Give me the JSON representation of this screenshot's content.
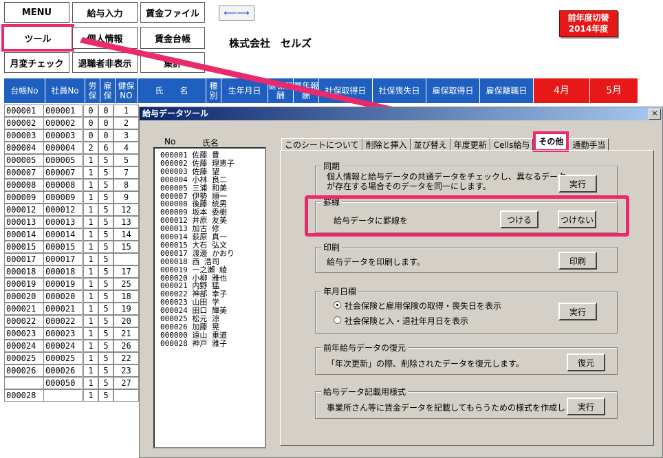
{
  "menu": {
    "items": [
      "MENU",
      "給与入力",
      "賃金ファイル",
      "ツール",
      "個人情報",
      "賃金台帳",
      "月変チェック",
      "退職者非表示",
      "集計"
    ]
  },
  "arrow_button": "⟵⟶",
  "company": "株式会社　セルズ",
  "prev_year": {
    "line1": "前年度切替",
    "line2": "2014年度"
  },
  "sheet": {
    "headers": [
      "台帳No",
      "社員No",
      "労保",
      "雇保",
      "健保NO",
      "氏　　名",
      "種別",
      "生年月日",
      "健保報酬",
      "厚年報酬",
      "社保取得日",
      "社保喪失日",
      "雇保取得日",
      "雇保離職日",
      "4月",
      "5月"
    ],
    "rows": [
      [
        "000001",
        "000001",
        "0",
        "0",
        "1"
      ],
      [
        "000002",
        "000002",
        "0",
        "0",
        "2"
      ],
      [
        "000003",
        "000003",
        "0",
        "0",
        "3"
      ],
      [
        "000004",
        "000004",
        "2",
        "6",
        "4"
      ],
      [
        "000005",
        "000005",
        "1",
        "5",
        "5"
      ],
      [
        "000007",
        "000007",
        "1",
        "5",
        "7"
      ],
      [
        "000008",
        "000008",
        "1",
        "5",
        "8"
      ],
      [
        "000009",
        "000009",
        "1",
        "5",
        "9"
      ],
      [
        "000012",
        "000012",
        "1",
        "5",
        "12"
      ],
      [
        "000013",
        "000013",
        "1",
        "5",
        "13"
      ],
      [
        "000014",
        "000014",
        "1",
        "5",
        "14"
      ],
      [
        "000015",
        "000015",
        "1",
        "5",
        "15"
      ],
      [
        "000017",
        "000017",
        "1",
        "5",
        ""
      ],
      [
        "000018",
        "000018",
        "1",
        "5",
        "17"
      ],
      [
        "000019",
        "000019",
        "1",
        "5",
        "25"
      ],
      [
        "000020",
        "000020",
        "1",
        "5",
        "18"
      ],
      [
        "000021",
        "000021",
        "1",
        "5",
        "19"
      ],
      [
        "000022",
        "000022",
        "1",
        "5",
        "20"
      ],
      [
        "000023",
        "000023",
        "1",
        "5",
        "21"
      ],
      [
        "000024",
        "000024",
        "1",
        "5",
        "26"
      ],
      [
        "000025",
        "000025",
        "1",
        "5",
        "22"
      ],
      [
        "000026",
        "000026",
        "1",
        "5",
        "23"
      ],
      [
        "",
        "000050",
        "1",
        "5",
        "27"
      ],
      [
        "000028",
        "",
        "1",
        "5",
        ""
      ]
    ]
  },
  "dialog": {
    "title": "給与データツール",
    "close": "×",
    "list_head_no": "No",
    "list_head_name": "氏名",
    "employees": [
      "000001 佐藤 豊",
      "000002 佐藤 理恵子",
      "000003 佐藤 望",
      "000004 小林 良二",
      "000005 三浦 和美",
      "000007 伊勢 順一",
      "000008 後藤 統男",
      "000009 坂本 委樹",
      "000012 井原 友美",
      "000013 加古 修",
      "000014 荻原 真一",
      "000015 大石 弘文",
      "000017 渡邊 かおり",
      "000018 西 浩司",
      "000019 一之瀬 綾",
      "000020 小柳 雅也",
      "000021 内野 猛",
      "000022 神部 幸子",
      "000023 山田 学",
      "000024 田口 輝美",
      "000025 松元 涼",
      "000026 加藤 晃",
      "000000 遠山 重道",
      "000028 神戸 雅子"
    ],
    "tabs": [
      "このシートについて",
      "削除と挿入",
      "並び替え",
      "年度更新",
      "Cells給与",
      "その他",
      "通勤手当"
    ],
    "groups": {
      "sync": {
        "title": "同期",
        "line1": "個人情報と給与データの共通データをチェックし、異なるデータ",
        "line2": "が存在する場合そのデータを同一にします。",
        "button": "実行"
      },
      "ruled": {
        "title": "罫線",
        "text": "給与データに罫線を",
        "button_on": "つける",
        "button_off": "つけない"
      },
      "print": {
        "title": "印刷",
        "text": "給与データを印刷します。",
        "button": "印刷"
      },
      "date": {
        "title": "年月日欄",
        "option1": "社会保険と雇用保険の取得・喪失日を表示",
        "option2": "社会保険と入・退社年月日を表示",
        "button": "実行"
      },
      "restore": {
        "title": "前年給与データの復元",
        "text": "「年次更新」の際、削除されたデータを復元します。",
        "button": "復元"
      },
      "form": {
        "title": "給与データ記載用様式",
        "text": "事業所さん等に賃金データを記載してもらうための様式を作成します。",
        "button": "実行"
      }
    }
  },
  "colors": {
    "accent": "#ea2a6e",
    "header_blue": "#1f5fbf",
    "header_red": "#e81818",
    "dialog_bg": "#d4d0c8"
  }
}
